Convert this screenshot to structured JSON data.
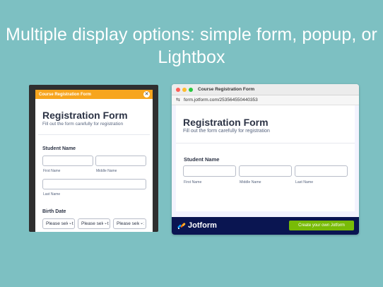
{
  "headline": {
    "line1": "Multiple display options: simple form, popup, or",
    "line2": "Lightbox"
  },
  "popup": {
    "titlebar_label": "Course Registration Form",
    "close_glyph": "✕",
    "form": {
      "title": "Registration Form",
      "subtitle": "Fill out the form carefully for registration",
      "student_name_label": "Student Name",
      "first_name": "First Name",
      "middle_name": "Middle Name",
      "last_name": "Last Name",
      "birth_date_label": "Birth Date",
      "select_placeholder": "Please select",
      "chevron": "⌄"
    },
    "colors": {
      "titlebar": "#f7a51e",
      "frame": "#2f2f2f"
    }
  },
  "browser": {
    "tab_title": "Course Registration Form",
    "url_icon": "⇆",
    "url": "form.jotform.com/253564550440353",
    "traffic_lights": [
      "#fe5f57",
      "#febc2e",
      "#28c840"
    ],
    "form": {
      "title": "Registration Form",
      "subtitle": "Fill out the form carefully for registration",
      "student_name_label": "Student Name",
      "first_name": "First Name",
      "middle_name": "Middle Name",
      "last_name": "Last Name"
    },
    "footer": {
      "brand": "Jotform",
      "cta_label": "Create your own Jotform",
      "colors": {
        "bar": "#0a1551",
        "cta": "#78bb07"
      }
    }
  }
}
